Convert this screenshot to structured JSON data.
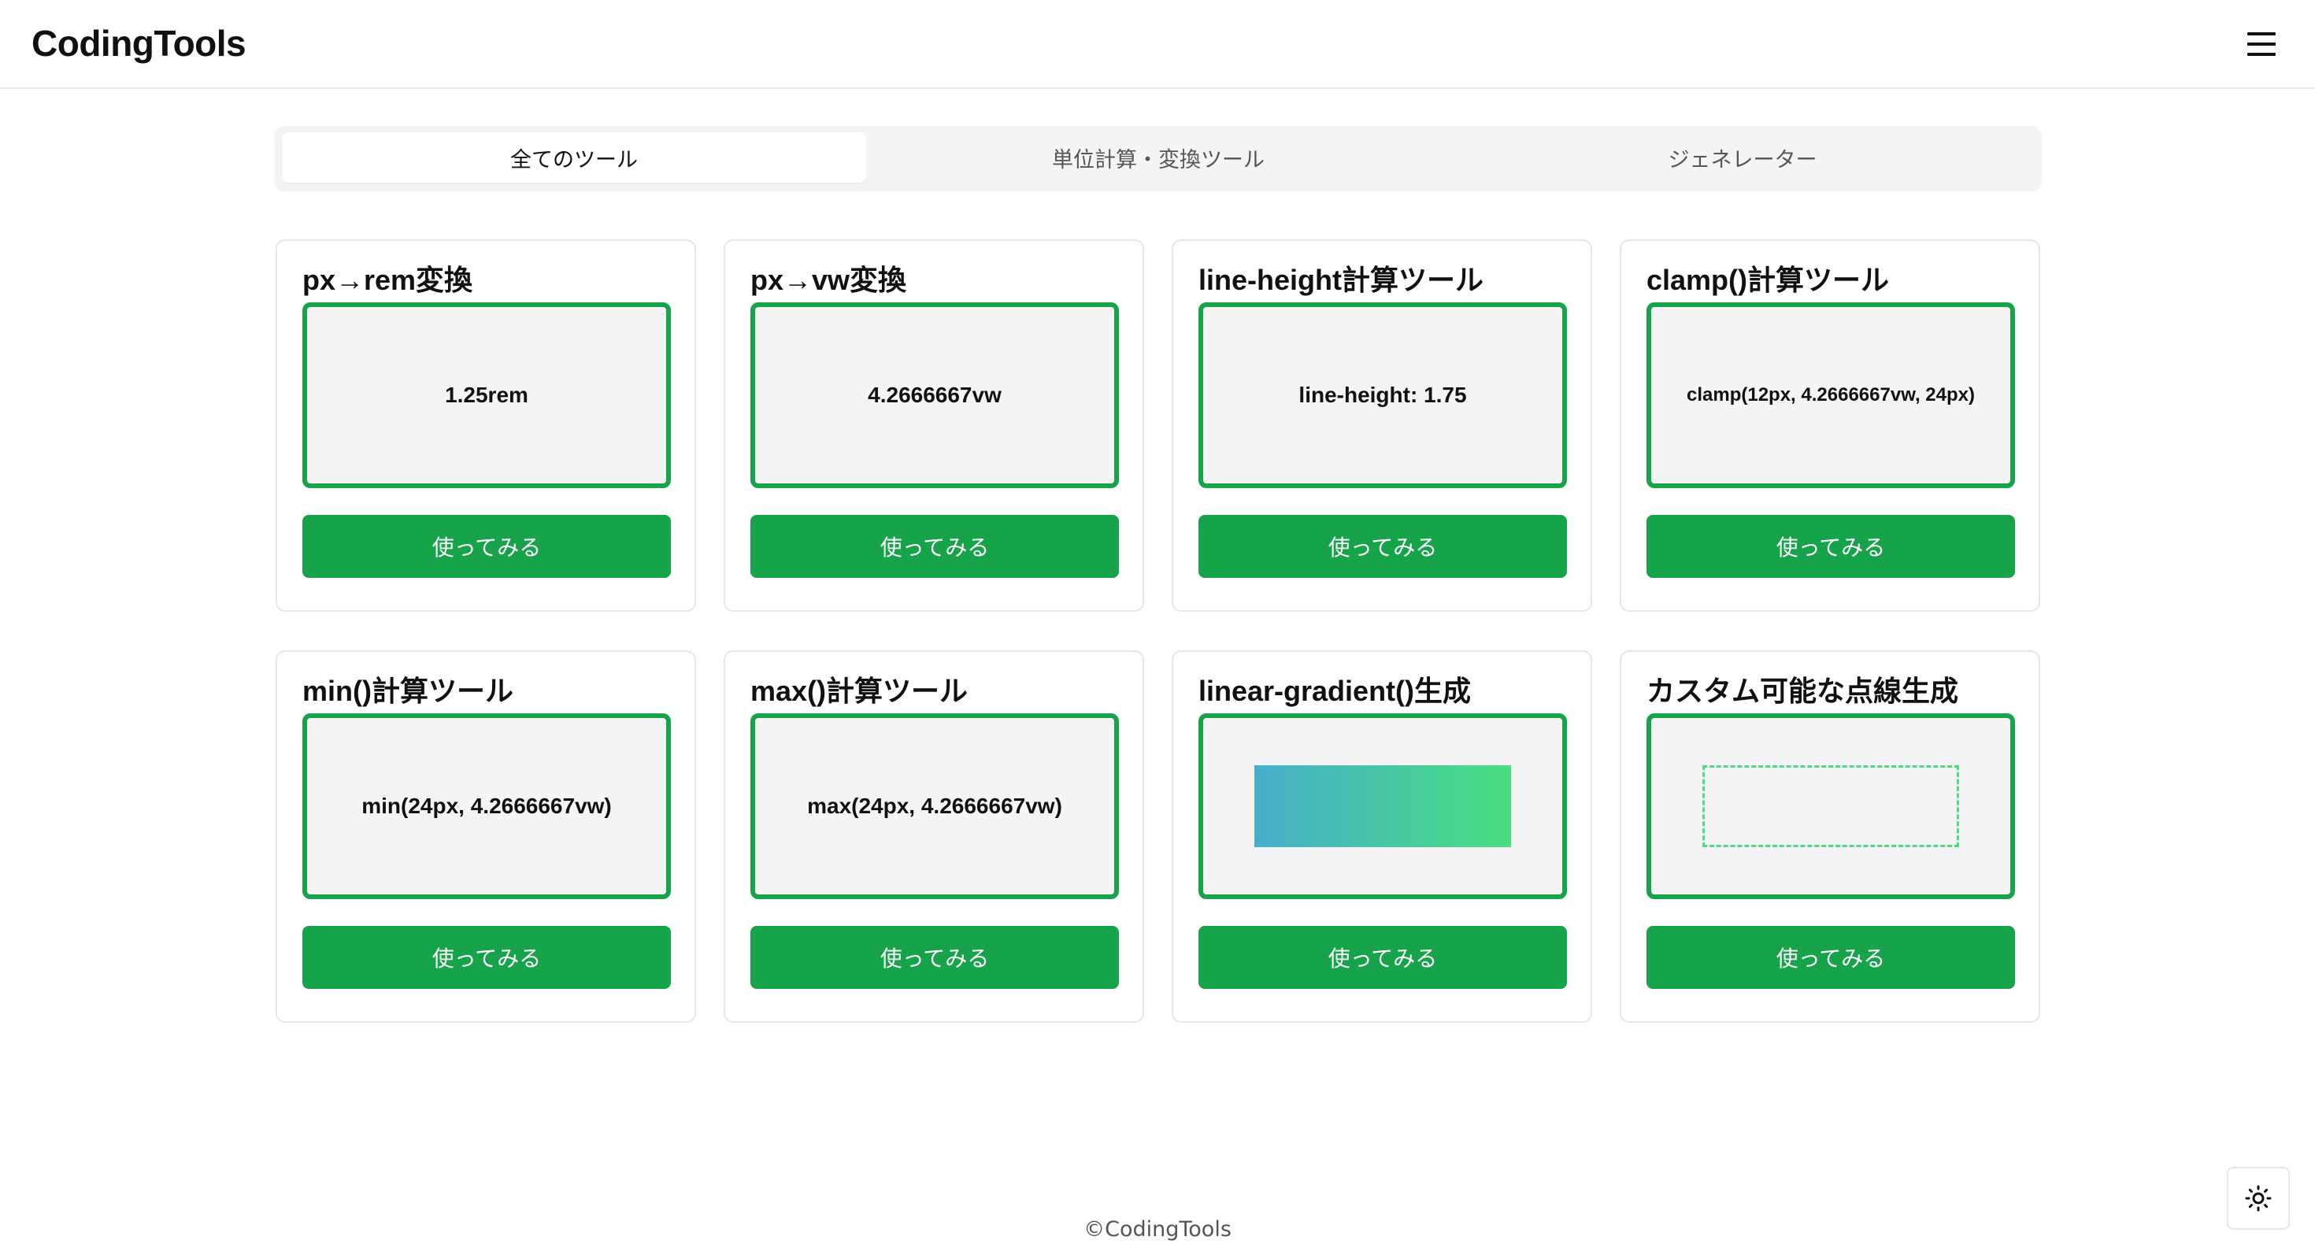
{
  "header": {
    "logo": "CodingTools",
    "menu_icon": "hamburger-menu-icon"
  },
  "tabs": [
    {
      "label": "全てのツール",
      "active": true
    },
    {
      "label": "単位計算・変換ツール",
      "active": false
    },
    {
      "label": "ジェネレーター",
      "active": false
    }
  ],
  "tools": [
    {
      "title": "px→rem変換",
      "preview": "1.25rem",
      "button": "使ってみる"
    },
    {
      "title": "px→vw変換",
      "preview": "4.2666667vw",
      "button": "使ってみる"
    },
    {
      "title": "line-height計算ツール",
      "preview": "line-height: 1.75",
      "button": "使ってみる"
    },
    {
      "title": "clamp()計算ツール",
      "preview": "clamp(12px, 4.2666667vw, 24px)",
      "button": "使ってみる"
    },
    {
      "title": "min()計算ツール",
      "preview": "min(24px, 4.2666667vw)",
      "button": "使ってみる"
    },
    {
      "title": "max()計算ツール",
      "preview": "max(24px, 4.2666667vw)",
      "button": "使ってみる"
    },
    {
      "title": "linear-gradient()生成",
      "preview_type": "gradient",
      "button": "使ってみる"
    },
    {
      "title": "カスタム可能な点線生成",
      "preview_type": "dashed-border",
      "button": "使ってみる"
    }
  ],
  "colors": {
    "accent": "#16a34a",
    "gradient_start": "#45aecb",
    "gradient_end": "#4ade80",
    "dashed": "#4ade80"
  },
  "footer": {
    "copyright": "©CodingTools",
    "theme_icon": "sun-icon"
  }
}
